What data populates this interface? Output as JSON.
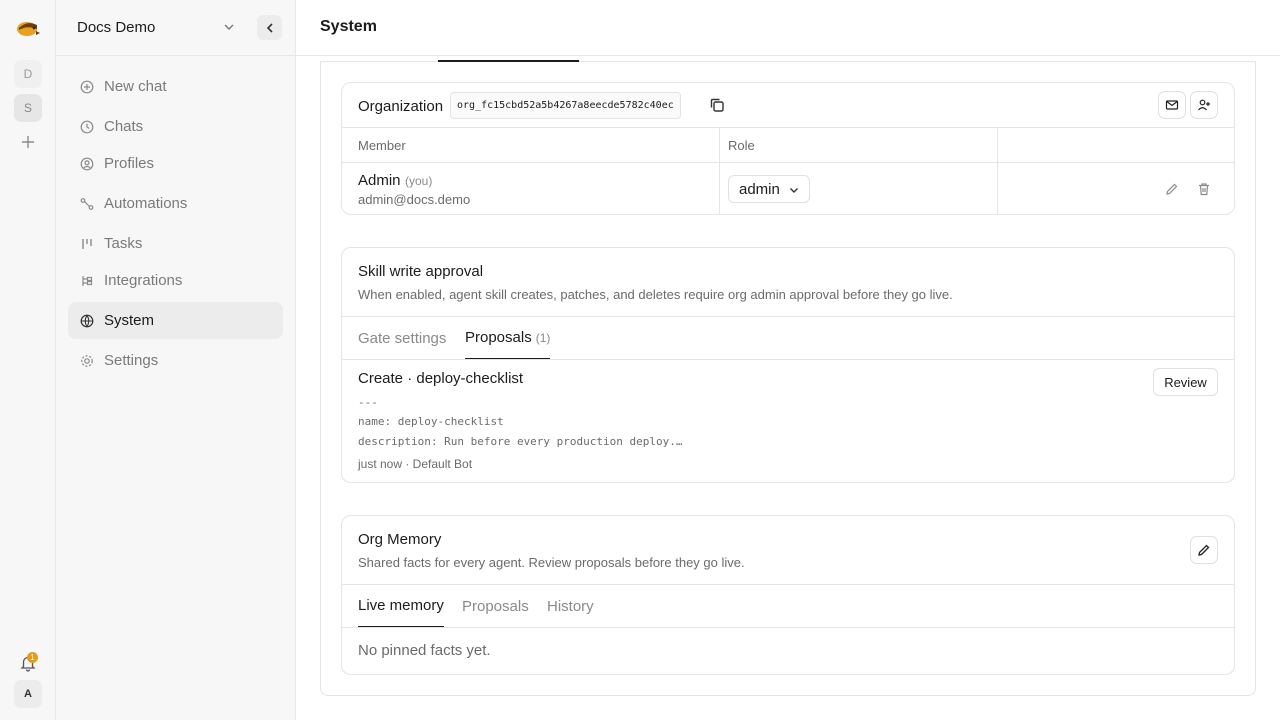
{
  "workspace": {
    "name": "Docs Demo",
    "rail_items": [
      "D",
      "S"
    ],
    "user_initial": "A",
    "notification_count": "1"
  },
  "sidebar": {
    "items": [
      {
        "label": "New chat",
        "icon": "plus-circle-icon"
      },
      {
        "label": "Chats",
        "icon": "clock-icon"
      },
      {
        "label": "Profiles",
        "icon": "user-circle-icon"
      },
      {
        "label": "Automations",
        "icon": "workflow-icon"
      },
      {
        "label": "Tasks",
        "icon": "tasks-icon"
      },
      {
        "label": "Integrations",
        "icon": "integrations-icon"
      },
      {
        "label": "System",
        "icon": "globe-icon",
        "active": true
      },
      {
        "label": "Settings",
        "icon": "gear-icon"
      }
    ]
  },
  "header": {
    "title": "System"
  },
  "organization": {
    "label": "Organization",
    "id": "org_fc15cbd52a5b4267a8eecde5782c40ec",
    "columns": [
      "Member",
      "Role"
    ],
    "members": [
      {
        "name": "Admin",
        "you": "(you)",
        "email": "admin@docs.demo",
        "role": "admin"
      }
    ]
  },
  "skill_approval": {
    "title": "Skill write approval",
    "description": "When enabled, agent skill creates, patches, and deletes require org admin approval before they go live.",
    "tabs": [
      {
        "label": "Gate settings",
        "active": false
      },
      {
        "label": "Proposals",
        "count": "(1)",
        "active": true
      }
    ],
    "proposal": {
      "title": "Create · deploy-checklist",
      "review_label": "Review",
      "code_lines": [
        "---",
        "name: deploy-checklist",
        "description: Run before every production deploy.…"
      ],
      "meta": "just now · Default Bot"
    }
  },
  "org_memory": {
    "title": "Org Memory",
    "description": "Shared facts for every agent. Review proposals before they go live.",
    "tabs": [
      {
        "label": "Live memory",
        "active": true
      },
      {
        "label": "Proposals",
        "active": false
      },
      {
        "label": "History",
        "active": false
      }
    ],
    "empty_text": "No pinned facts yet."
  },
  "colors": {
    "accent": "#e89a1c",
    "text": "#1c1c1c",
    "muted": "#6b6b6b",
    "border": "#e5e5e5"
  }
}
